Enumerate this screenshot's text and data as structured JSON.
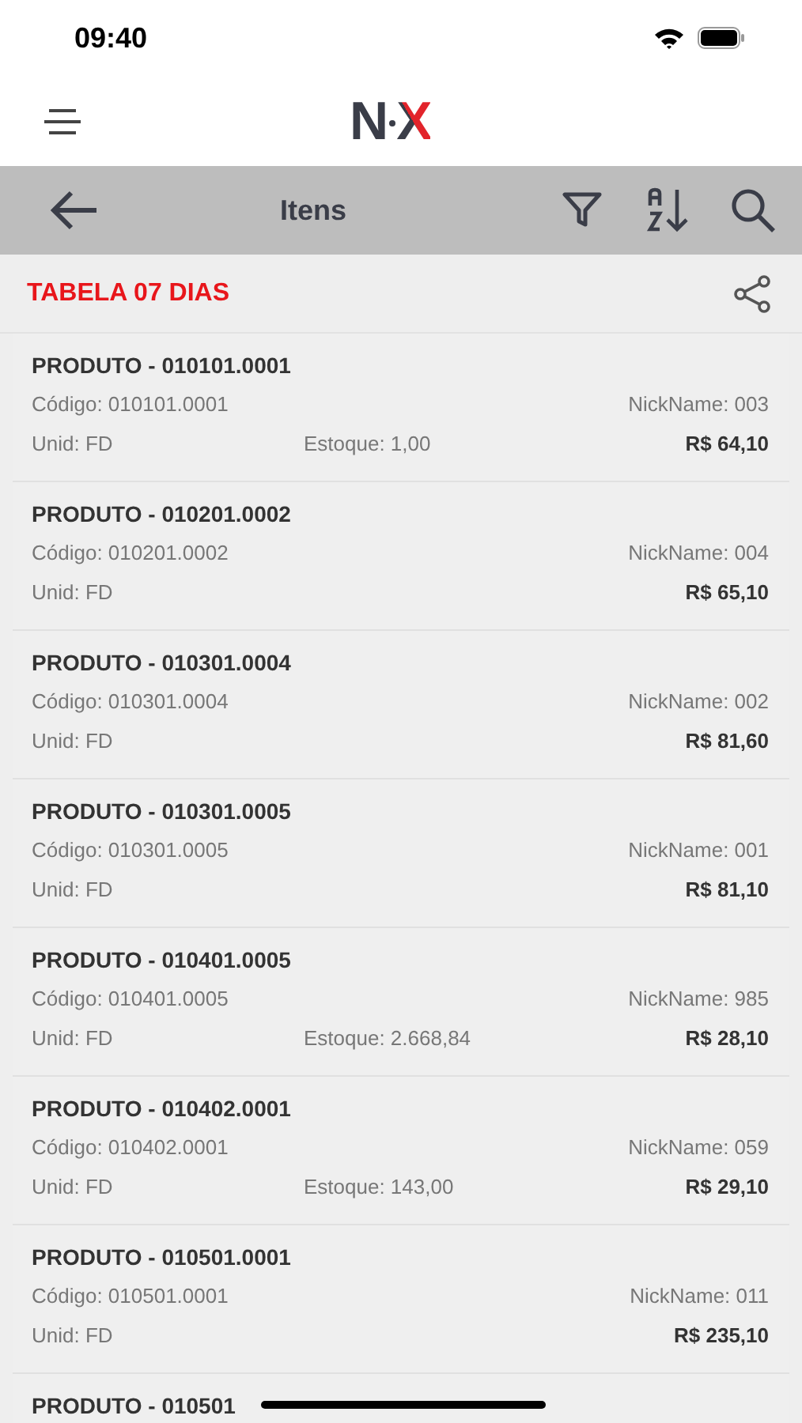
{
  "status_bar": {
    "time": "09:40"
  },
  "header": {
    "logo": "NX"
  },
  "toolbar": {
    "title": "Itens"
  },
  "section": {
    "title": "TABELA 07 DIAS"
  },
  "products": [
    {
      "title": "PRODUTO - 010101.0001",
      "code": "Código: 010101.0001",
      "nickname": "NickName: 003",
      "unit": "Unid: FD",
      "stock": "Estoque: 1,00",
      "price": "R$ 64,10"
    },
    {
      "title": "PRODUTO - 010201.0002",
      "code": "Código: 010201.0002",
      "nickname": "NickName: 004",
      "unit": "Unid: FD",
      "price": "R$ 65,10"
    },
    {
      "title": "PRODUTO - 010301.0004",
      "code": "Código: 010301.0004",
      "nickname": "NickName: 002",
      "unit": "Unid: FD",
      "price": "R$ 81,60"
    },
    {
      "title": "PRODUTO - 010301.0005",
      "code": "Código: 010301.0005",
      "nickname": "NickName: 001",
      "unit": "Unid: FD",
      "price": "R$ 81,10"
    },
    {
      "title": "PRODUTO - 010401.0005",
      "code": "Código: 010401.0005",
      "nickname": "NickName: 985",
      "unit": "Unid: FD",
      "stock": "Estoque: 2.668,84",
      "price": "R$ 28,10"
    },
    {
      "title": "PRODUTO - 010402.0001",
      "code": "Código: 010402.0001",
      "nickname": "NickName: 059",
      "unit": "Unid: FD",
      "stock": "Estoque: 143,00",
      "price": "R$ 29,10"
    },
    {
      "title": "PRODUTO - 010501.0001",
      "code": "Código: 010501.0001",
      "nickname": "NickName: 011",
      "unit": "Unid: FD",
      "price": "R$ 235,10"
    },
    {
      "title": "PRODUTO - 010501"
    }
  ]
}
